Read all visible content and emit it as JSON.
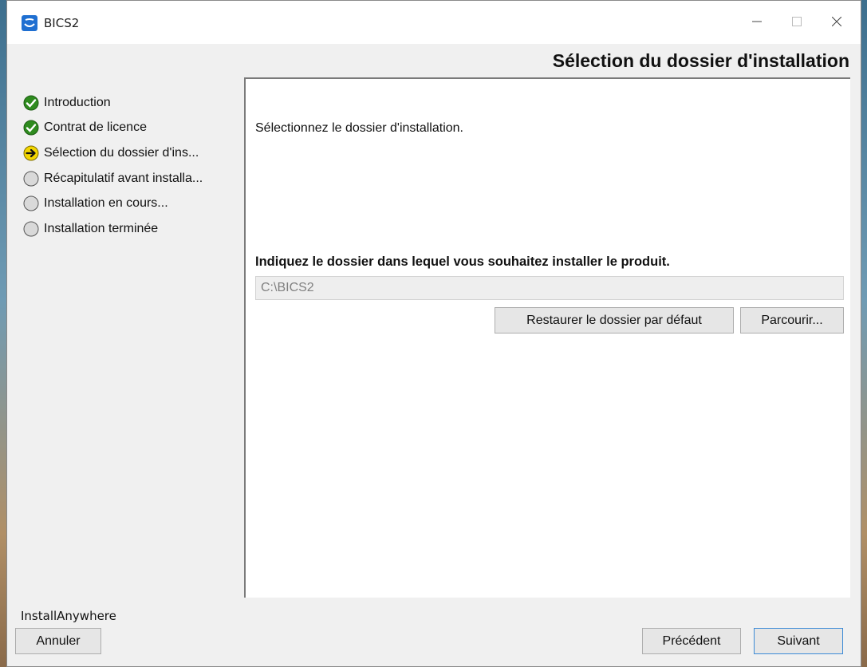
{
  "window": {
    "title": "BICS2",
    "controls": {
      "minimize": "minimize",
      "maximize": "maximize",
      "close": "close"
    }
  },
  "page": {
    "heading": "Sélection du dossier d'installation"
  },
  "steps": [
    {
      "label": "Introduction",
      "status": "done"
    },
    {
      "label": "Contrat de licence",
      "status": "done"
    },
    {
      "label": "Sélection du dossier d'ins...",
      "status": "current"
    },
    {
      "label": "Récapitulatif avant installa...",
      "status": "pending"
    },
    {
      "label": "Installation en cours...",
      "status": "pending"
    },
    {
      "label": "Installation terminée",
      "status": "pending"
    }
  ],
  "content": {
    "intro": "Sélectionnez le dossier d'installation.",
    "folder_label": "Indiquez le dossier dans lequel vous souhaitez installer le produit.",
    "folder_value": "C:\\BICS2",
    "restore_button": "Restaurer le dossier par défaut",
    "browse_button": "Parcourir..."
  },
  "footer": {
    "brand": "InstallAnywhere",
    "cancel_button": "Annuler",
    "back_button": "Précédent",
    "next_button": "Suivant"
  },
  "colors": {
    "done": "#2e8b1e",
    "current": "#f2d500",
    "pending": "#d9d9d9",
    "accent_border": "#3c8ad6"
  },
  "icons": {
    "done": "check-circle-icon",
    "current": "arrow-circle-icon",
    "pending": "empty-circle-icon"
  }
}
